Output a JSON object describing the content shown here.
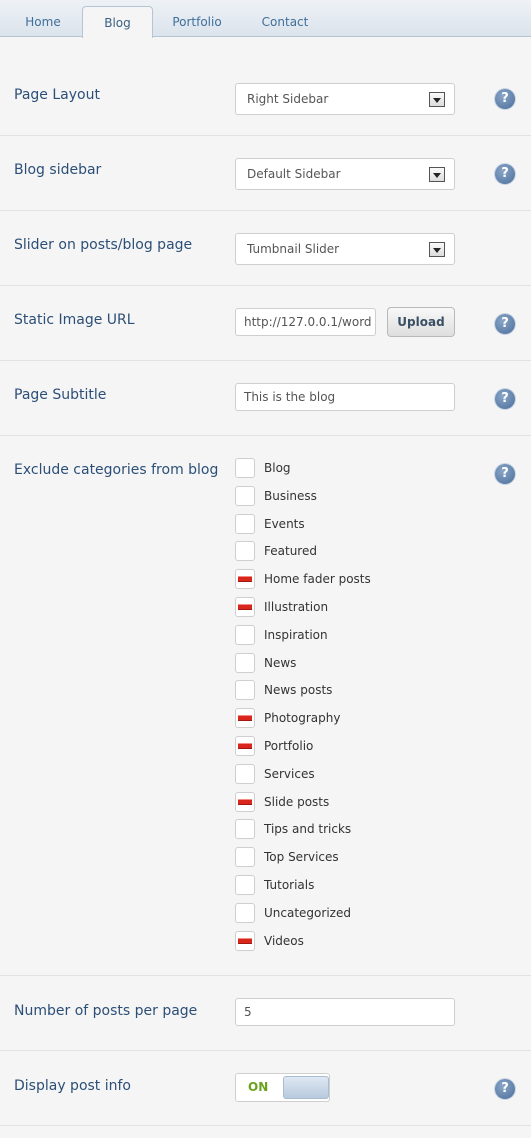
{
  "tabs": [
    "Home",
    "Blog",
    "Portfolio",
    "Contact"
  ],
  "help_glyph": "?",
  "page_layout": {
    "label": "Page Layout",
    "value": "Right Sidebar"
  },
  "blog_sidebar": {
    "label": "Blog sidebar",
    "value": "Default Sidebar"
  },
  "slider": {
    "label": "Slider on posts/blog page",
    "value": "Tumbnail Slider"
  },
  "static_image": {
    "label": "Static Image URL",
    "value": "http://127.0.0.1/word",
    "upload_label": "Upload"
  },
  "page_subtitle": {
    "label": "Page Subtitle",
    "value": "This is the blog"
  },
  "exclude": {
    "label": "Exclude categories from blog",
    "categories": [
      {
        "name": "Blog",
        "checked": false
      },
      {
        "name": "Business",
        "checked": false
      },
      {
        "name": "Events",
        "checked": false
      },
      {
        "name": "Featured",
        "checked": false
      },
      {
        "name": "Home fader posts",
        "checked": true
      },
      {
        "name": "Illustration",
        "checked": true
      },
      {
        "name": "Inspiration",
        "checked": false
      },
      {
        "name": "News",
        "checked": false
      },
      {
        "name": "News posts",
        "checked": false
      },
      {
        "name": "Photography",
        "checked": true
      },
      {
        "name": "Portfolio",
        "checked": true
      },
      {
        "name": "Services",
        "checked": false
      },
      {
        "name": "Slide posts",
        "checked": true
      },
      {
        "name": "Tips and tricks",
        "checked": false
      },
      {
        "name": "Top Services",
        "checked": false
      },
      {
        "name": "Tutorials",
        "checked": false
      },
      {
        "name": "Uncategorized",
        "checked": false
      },
      {
        "name": "Videos",
        "checked": true
      }
    ]
  },
  "posts_per_page": {
    "label": "Number of posts per page",
    "value": "5"
  },
  "post_info": {
    "label": "Display post info",
    "state": "ON"
  },
  "colors": {
    "accent": "#2c4f77",
    "checked_mark": "#d9261c",
    "toggle_on_text": "#6aa21d"
  }
}
